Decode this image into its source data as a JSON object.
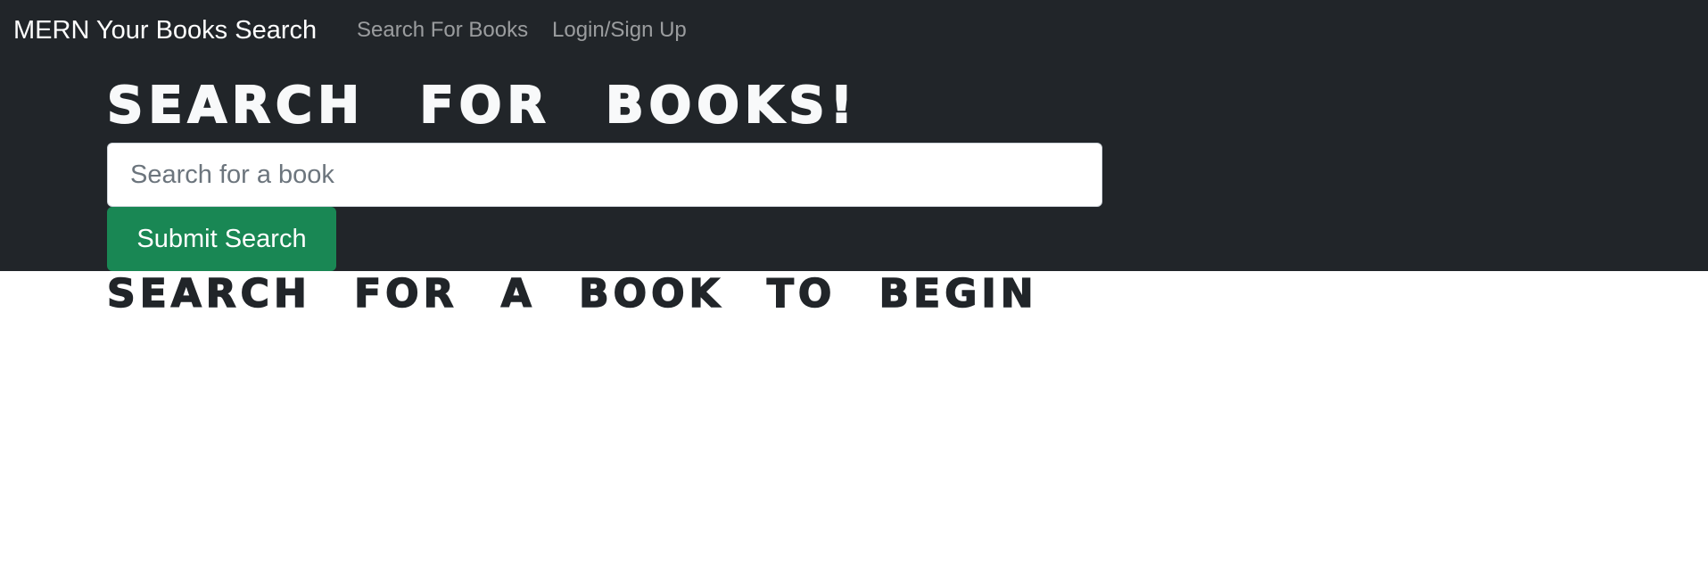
{
  "navbar": {
    "brand": "MERN Your Books Search",
    "links": [
      {
        "label": "Search For Books"
      },
      {
        "label": "Login/Sign Up"
      }
    ]
  },
  "hero": {
    "title": "SEARCH FOR BOOKS!",
    "search": {
      "value": "",
      "placeholder": "Search for a book"
    },
    "submit_label": "Submit Search"
  },
  "results": {
    "heading": "SEARCH FOR A BOOK TO BEGIN"
  },
  "colors": {
    "navbar_bg": "#212529",
    "submit_bg": "#198754",
    "hero_text": "#f8f9fa",
    "page_text": "#212529"
  }
}
